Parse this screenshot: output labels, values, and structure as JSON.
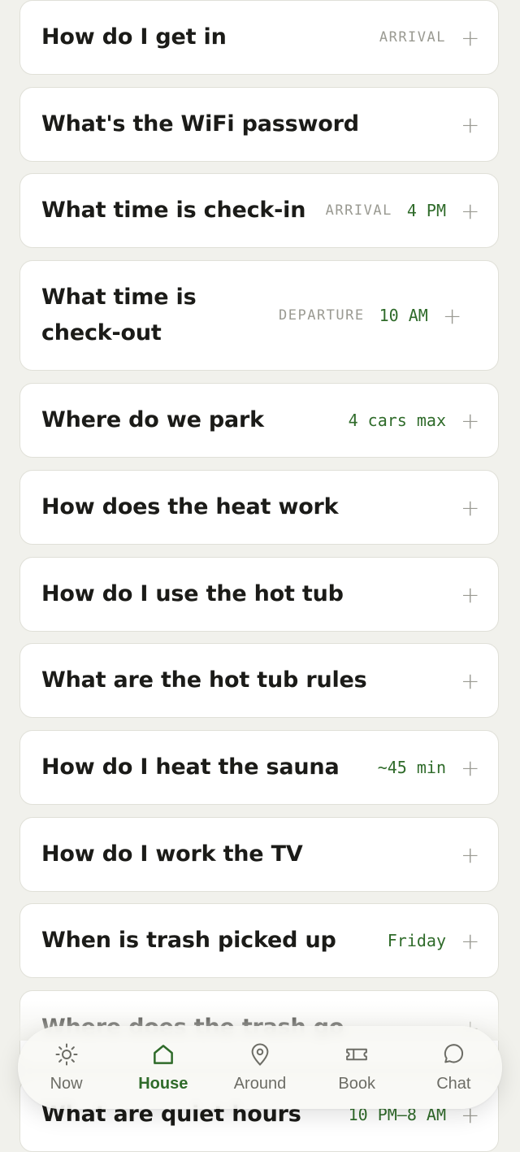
{
  "faq": [
    {
      "question": "How do I get in",
      "tag": "ARRIVAL",
      "value": "",
      "plus": "+"
    },
    {
      "question": "What's the WiFi password",
      "tag": "",
      "value": "",
      "plus": "+"
    },
    {
      "question": "What time is check-in",
      "tag": "ARRIVAL",
      "value": "4 PM",
      "plus": "+"
    },
    {
      "question": "What time is check-out",
      "tag": "DEPARTURE",
      "value": "10 AM",
      "plus": "+"
    },
    {
      "question": "Where do we park",
      "tag": "",
      "value": "4 cars max",
      "plus": "+"
    },
    {
      "question": "How does the heat work",
      "tag": "",
      "value": "",
      "plus": "+"
    },
    {
      "question": "How do I use the hot tub",
      "tag": "",
      "value": "",
      "plus": "+"
    },
    {
      "question": "What are the hot tub rules",
      "tag": "",
      "value": "",
      "plus": "+"
    },
    {
      "question": "How do I heat the sauna",
      "tag": "",
      "value": "~45 min",
      "plus": "+"
    },
    {
      "question": "How do I work the TV",
      "tag": "",
      "value": "",
      "plus": "+"
    },
    {
      "question": "When is trash picked up",
      "tag": "",
      "value": "Friday",
      "plus": "+"
    },
    {
      "question": "Where does the trash go",
      "tag": "",
      "value": "",
      "plus": "+"
    },
    {
      "question": "What are quiet hours",
      "tag": "",
      "value": "10 PM–8 AM",
      "plus": "+"
    }
  ],
  "nav": {
    "items": [
      {
        "label": "Now",
        "icon": "sun-icon"
      },
      {
        "label": "House",
        "icon": "house-icon",
        "active": true
      },
      {
        "label": "Around",
        "icon": "map-pin-icon"
      },
      {
        "label": "Book",
        "icon": "ticket-icon"
      },
      {
        "label": "Chat",
        "icon": "chat-bubble-icon"
      }
    ]
  },
  "colors": {
    "accent": "#2f6b2a",
    "muted": "#9a9a92",
    "background": "#f1f1ec",
    "card": "#ffffff"
  }
}
